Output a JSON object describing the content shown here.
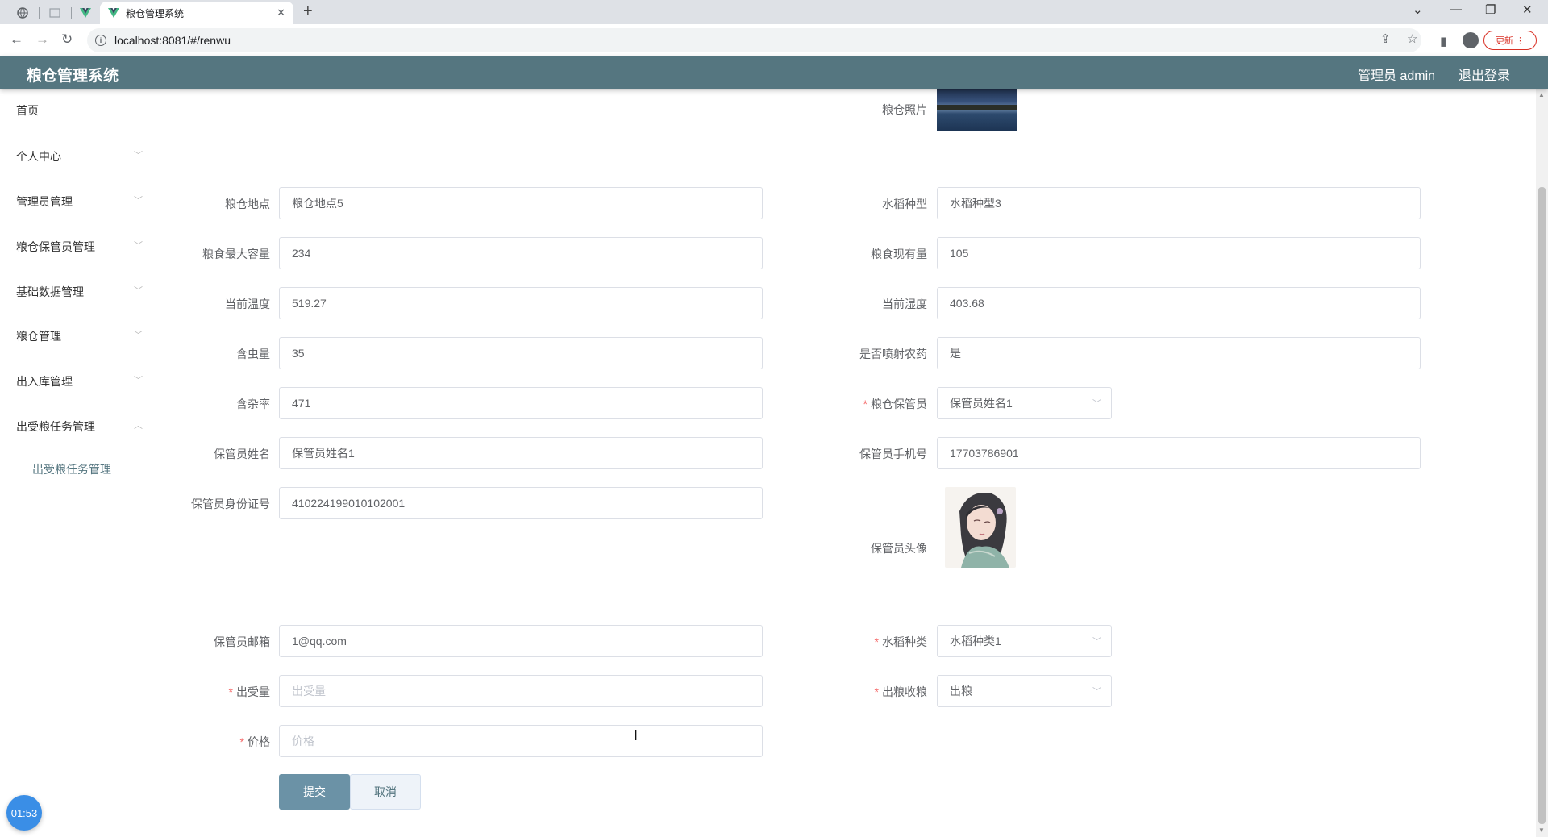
{
  "browser": {
    "tab_title": "粮仓管理系统",
    "url": "localhost:8081/#/renwu",
    "update_label": "更新"
  },
  "header": {
    "title": "粮仓管理系统",
    "user": "管理员 admin",
    "logout": "退出登录"
  },
  "sidebar": {
    "items": [
      {
        "label": "首页"
      },
      {
        "label": "个人中心"
      },
      {
        "label": "管理员管理"
      },
      {
        "label": "粮仓保管员管理"
      },
      {
        "label": "基础数据管理"
      },
      {
        "label": "粮仓管理"
      },
      {
        "label": "出入库管理"
      },
      {
        "label": "出受粮任务管理"
      },
      {
        "label": "出受粮任务管理"
      }
    ]
  },
  "form": {
    "photo_label": "粮仓照片",
    "location_label": "粮仓地点",
    "location_value": "粮仓地点5",
    "rice_type_label": "水稻种型",
    "rice_type_value": "水稻种型3",
    "max_capacity_label": "粮食最大容量",
    "max_capacity_value": "234",
    "current_amount_label": "粮食现有量",
    "current_amount_value": "105",
    "temperature_label": "当前温度",
    "temperature_value": "519.27",
    "humidity_label": "当前湿度",
    "humidity_value": "403.68",
    "insect_label": "含虫量",
    "insect_value": "35",
    "pesticide_label": "是否喷射农药",
    "pesticide_value": "是",
    "impurity_label": "含杂率",
    "impurity_value": "471",
    "keeper_label": "粮仓保管员",
    "keeper_value": "保管员姓名1",
    "keeper_name_label": "保管员姓名",
    "keeper_name_value": "保管员姓名1",
    "keeper_phone_label": "保管员手机号",
    "keeper_phone_value": "17703786901",
    "keeper_id_label": "保管员身份证号",
    "keeper_id_value": "410224199010102001",
    "keeper_avatar_label": "保管员头像",
    "keeper_email_label": "保管员邮箱",
    "keeper_email_value": "1@qq.com",
    "rice_kind_label": "水稻种类",
    "rice_kind_value": "水稻种类1",
    "out_amount_label": "出受量",
    "out_amount_placeholder": "出受量",
    "direction_label": "出粮收粮",
    "direction_value": "出粮",
    "price_label": "价格",
    "price_placeholder": "价格"
  },
  "buttons": {
    "submit": "提交",
    "cancel": "取消"
  },
  "timer": "01:53"
}
